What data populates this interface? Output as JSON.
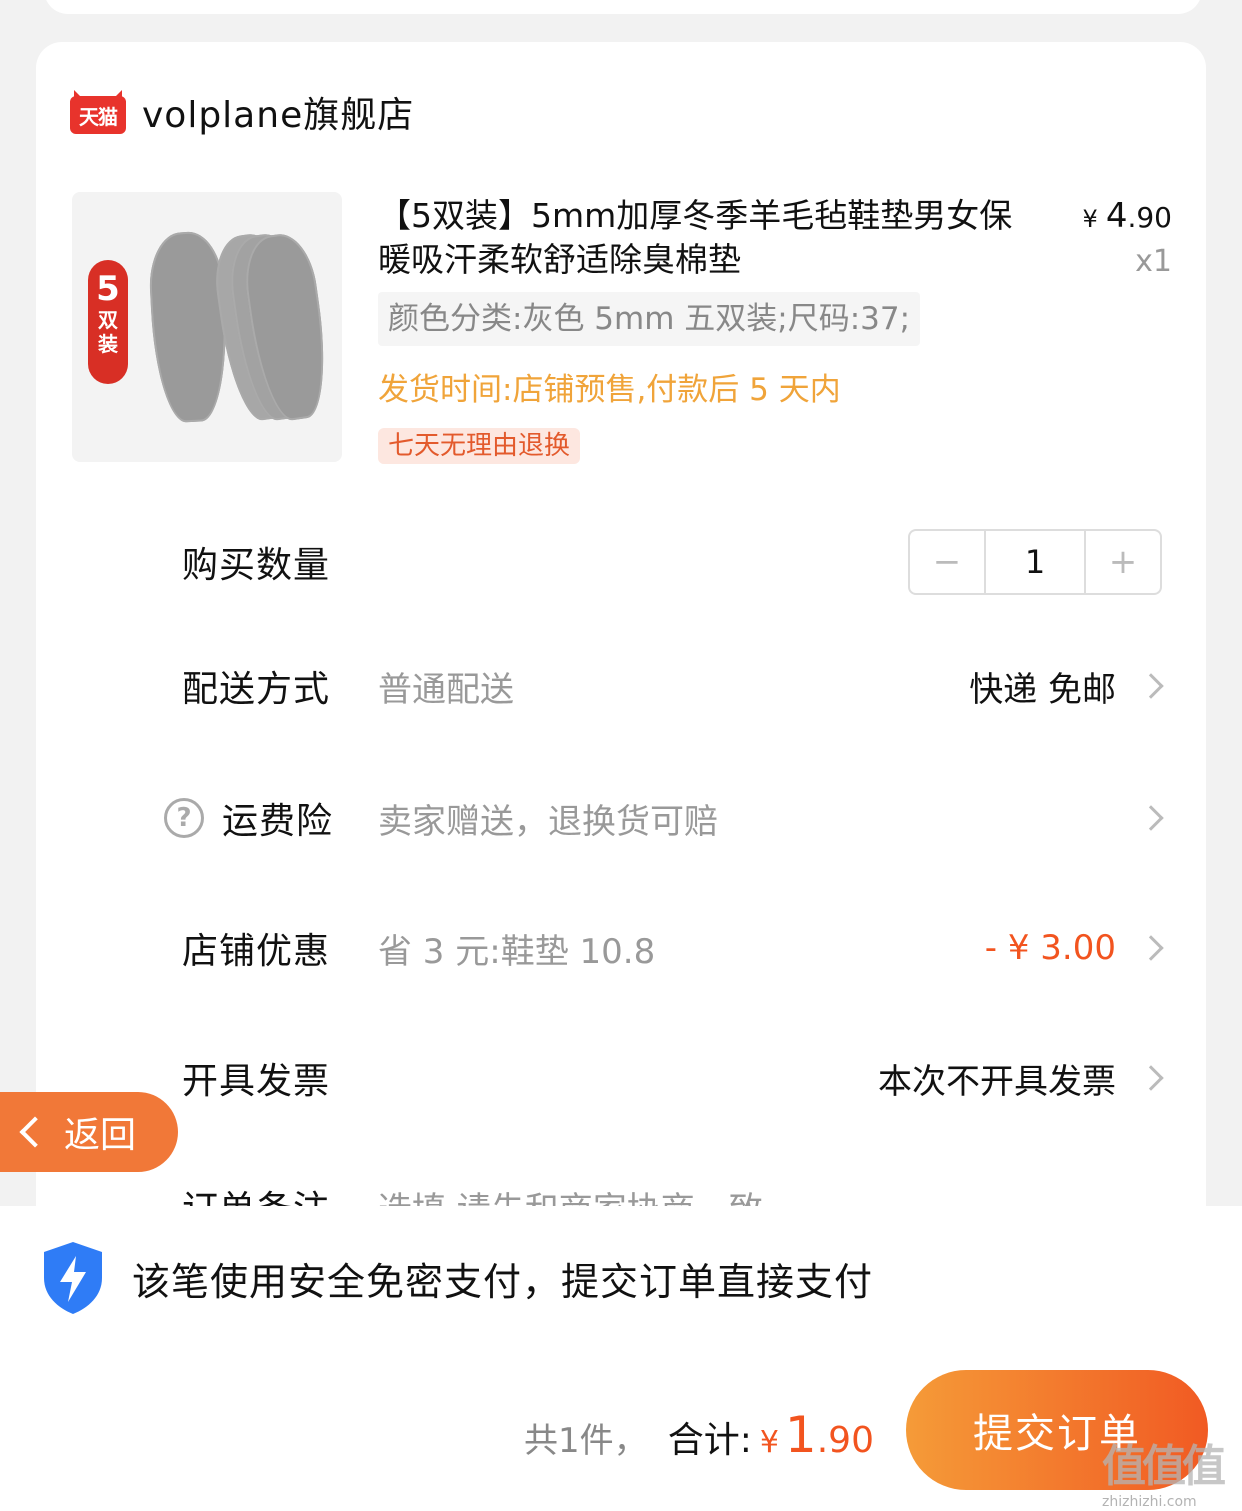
{
  "shop": {
    "logo_text": "天猫",
    "name": "volplane旗舰店"
  },
  "product": {
    "title": "【5双装】5mm加厚冬季羊毛毡鞋垫男女保暖吸汗柔软舒适除臭棉垫",
    "price_currency": "¥",
    "price_int": "4",
    "price_dec": ".90",
    "quantity_label": "x1",
    "sku": "颜色分类:灰色 5mm 五双装;尺码:37;",
    "shipping_time": "发货时间:店铺预售,付款后 5 天内",
    "return_tag": "七天无理由退换",
    "badge_num": "5",
    "badge_text1": "双",
    "badge_text2": "装"
  },
  "rows": {
    "quantity": {
      "label": "购买数量",
      "minus": "−",
      "value": "1",
      "plus": "+"
    },
    "delivery": {
      "label": "配送方式",
      "desc": "普通配送",
      "value": "快递 免邮"
    },
    "insurance": {
      "label": "运费险",
      "desc": "卖家赠送，退换货可赔",
      "help": "?"
    },
    "discount": {
      "label": "店铺优惠",
      "desc": "省 3 元:鞋垫 10.8",
      "value": "- ¥ 3.00"
    },
    "invoice": {
      "label": "开具发票",
      "value": "本次不开具发票"
    },
    "remark": {
      "label": "订单备注",
      "desc": "选填,请先和商家协商一致"
    }
  },
  "back": {
    "label": "返回"
  },
  "bottom": {
    "secure_text": "该笔使用安全免密支付，提交订单直接支付",
    "count_text": "共1件，",
    "total_label": "合计:",
    "total_currency": "¥",
    "total_int": "1",
    "total_dec": ".90",
    "submit_label": "提交订单"
  },
  "watermark": {
    "big": "值值值",
    "small": "zhizhizhi.com"
  },
  "colors": {
    "accent": "#f2541f",
    "ship": "#f0a43a",
    "back": "#f17838",
    "shield": "#2f7cf6"
  }
}
